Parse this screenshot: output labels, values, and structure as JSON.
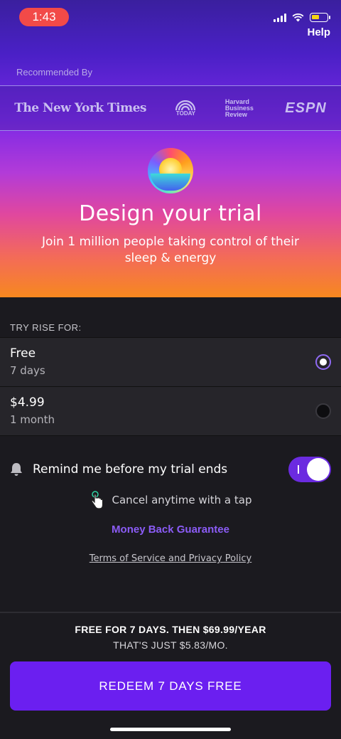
{
  "status_bar": {
    "time": "1:43",
    "help": "Help"
  },
  "hero": {
    "recommended_label": "Recommended By",
    "logos": [
      "The New York Times",
      "TODAY",
      "Harvard Business Review",
      "ESPN"
    ],
    "title": "Design your trial",
    "subtitle": "Join 1 million people taking control of their sleep & energy"
  },
  "plans": {
    "label": "TRY RISE FOR:",
    "items": [
      {
        "name": "Free",
        "duration": "7 days",
        "selected": true
      },
      {
        "name": "$4.99",
        "duration": "1 month",
        "selected": false
      }
    ]
  },
  "remind": {
    "label": "Remind me before my trial ends",
    "toggle_on": true,
    "toggle_bar": "I"
  },
  "cancel_text": "Cancel anytime with a tap",
  "money_back": "Money Back Guarantee",
  "terms": "Terms of Service and Privacy Policy",
  "pricing": {
    "line1": "FREE FOR 7 DAYS. THEN $69.99/YEAR",
    "line2": "THAT'S JUST $5.83/MO."
  },
  "cta": "REDEEM 7 DAYS FREE",
  "colors": {
    "accent": "#6b1ff0",
    "money_back": "#8b5cf6",
    "time_pill": "#f24a48"
  }
}
